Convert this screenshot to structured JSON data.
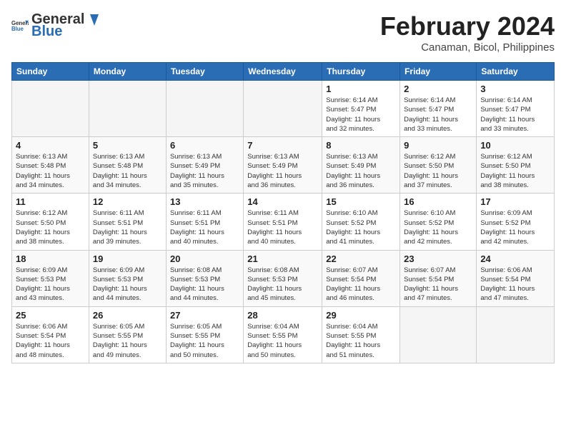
{
  "header": {
    "logo_general": "General",
    "logo_blue": "Blue",
    "month_year": "February 2024",
    "location": "Canaman, Bicol, Philippines"
  },
  "days_of_week": [
    "Sunday",
    "Monday",
    "Tuesday",
    "Wednesday",
    "Thursday",
    "Friday",
    "Saturday"
  ],
  "weeks": [
    [
      {
        "day": "",
        "info": ""
      },
      {
        "day": "",
        "info": ""
      },
      {
        "day": "",
        "info": ""
      },
      {
        "day": "",
        "info": ""
      },
      {
        "day": "1",
        "info": "Sunrise: 6:14 AM\nSunset: 5:47 PM\nDaylight: 11 hours\nand 32 minutes."
      },
      {
        "day": "2",
        "info": "Sunrise: 6:14 AM\nSunset: 5:47 PM\nDaylight: 11 hours\nand 33 minutes."
      },
      {
        "day": "3",
        "info": "Sunrise: 6:14 AM\nSunset: 5:47 PM\nDaylight: 11 hours\nand 33 minutes."
      }
    ],
    [
      {
        "day": "4",
        "info": "Sunrise: 6:13 AM\nSunset: 5:48 PM\nDaylight: 11 hours\nand 34 minutes."
      },
      {
        "day": "5",
        "info": "Sunrise: 6:13 AM\nSunset: 5:48 PM\nDaylight: 11 hours\nand 34 minutes."
      },
      {
        "day": "6",
        "info": "Sunrise: 6:13 AM\nSunset: 5:49 PM\nDaylight: 11 hours\nand 35 minutes."
      },
      {
        "day": "7",
        "info": "Sunrise: 6:13 AM\nSunset: 5:49 PM\nDaylight: 11 hours\nand 36 minutes."
      },
      {
        "day": "8",
        "info": "Sunrise: 6:13 AM\nSunset: 5:49 PM\nDaylight: 11 hours\nand 36 minutes."
      },
      {
        "day": "9",
        "info": "Sunrise: 6:12 AM\nSunset: 5:50 PM\nDaylight: 11 hours\nand 37 minutes."
      },
      {
        "day": "10",
        "info": "Sunrise: 6:12 AM\nSunset: 5:50 PM\nDaylight: 11 hours\nand 38 minutes."
      }
    ],
    [
      {
        "day": "11",
        "info": "Sunrise: 6:12 AM\nSunset: 5:50 PM\nDaylight: 11 hours\nand 38 minutes."
      },
      {
        "day": "12",
        "info": "Sunrise: 6:11 AM\nSunset: 5:51 PM\nDaylight: 11 hours\nand 39 minutes."
      },
      {
        "day": "13",
        "info": "Sunrise: 6:11 AM\nSunset: 5:51 PM\nDaylight: 11 hours\nand 40 minutes."
      },
      {
        "day": "14",
        "info": "Sunrise: 6:11 AM\nSunset: 5:51 PM\nDaylight: 11 hours\nand 40 minutes."
      },
      {
        "day": "15",
        "info": "Sunrise: 6:10 AM\nSunset: 5:52 PM\nDaylight: 11 hours\nand 41 minutes."
      },
      {
        "day": "16",
        "info": "Sunrise: 6:10 AM\nSunset: 5:52 PM\nDaylight: 11 hours\nand 42 minutes."
      },
      {
        "day": "17",
        "info": "Sunrise: 6:09 AM\nSunset: 5:52 PM\nDaylight: 11 hours\nand 42 minutes."
      }
    ],
    [
      {
        "day": "18",
        "info": "Sunrise: 6:09 AM\nSunset: 5:53 PM\nDaylight: 11 hours\nand 43 minutes."
      },
      {
        "day": "19",
        "info": "Sunrise: 6:09 AM\nSunset: 5:53 PM\nDaylight: 11 hours\nand 44 minutes."
      },
      {
        "day": "20",
        "info": "Sunrise: 6:08 AM\nSunset: 5:53 PM\nDaylight: 11 hours\nand 44 minutes."
      },
      {
        "day": "21",
        "info": "Sunrise: 6:08 AM\nSunset: 5:53 PM\nDaylight: 11 hours\nand 45 minutes."
      },
      {
        "day": "22",
        "info": "Sunrise: 6:07 AM\nSunset: 5:54 PM\nDaylight: 11 hours\nand 46 minutes."
      },
      {
        "day": "23",
        "info": "Sunrise: 6:07 AM\nSunset: 5:54 PM\nDaylight: 11 hours\nand 47 minutes."
      },
      {
        "day": "24",
        "info": "Sunrise: 6:06 AM\nSunset: 5:54 PM\nDaylight: 11 hours\nand 47 minutes."
      }
    ],
    [
      {
        "day": "25",
        "info": "Sunrise: 6:06 AM\nSunset: 5:54 PM\nDaylight: 11 hours\nand 48 minutes."
      },
      {
        "day": "26",
        "info": "Sunrise: 6:05 AM\nSunset: 5:55 PM\nDaylight: 11 hours\nand 49 minutes."
      },
      {
        "day": "27",
        "info": "Sunrise: 6:05 AM\nSunset: 5:55 PM\nDaylight: 11 hours\nand 50 minutes."
      },
      {
        "day": "28",
        "info": "Sunrise: 6:04 AM\nSunset: 5:55 PM\nDaylight: 11 hours\nand 50 minutes."
      },
      {
        "day": "29",
        "info": "Sunrise: 6:04 AM\nSunset: 5:55 PM\nDaylight: 11 hours\nand 51 minutes."
      },
      {
        "day": "",
        "info": ""
      },
      {
        "day": "",
        "info": ""
      }
    ]
  ]
}
